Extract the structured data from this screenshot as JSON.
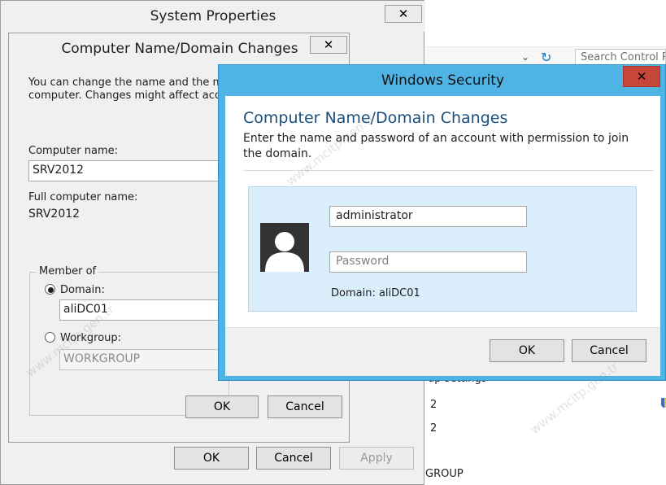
{
  "system_properties": {
    "title": "System Properties",
    "close_glyph": "✕",
    "ok_label": "OK",
    "cancel_label": "Cancel",
    "apply_label": "Apply"
  },
  "computer_name_dialog": {
    "title": "Computer Name/Domain Changes",
    "close_glyph": "✕",
    "intro_line1": "You can change the name and the mem",
    "intro_line2": "computer. Changes might affect access",
    "computer_name_label": "Computer name:",
    "computer_name_value": "SRV2012",
    "full_name_label": "Full computer name:",
    "full_name_value": "SRV2012",
    "member_of_label": "Member of",
    "domain_label": "Domain:",
    "domain_value": "aliDC01",
    "workgroup_label": "Workgroup:",
    "workgroup_value": "WORKGROUP",
    "ok_label": "OK",
    "cancel_label": "Cancel"
  },
  "windows_security": {
    "title": "Windows Security",
    "close_glyph": "✕",
    "heading": "Computer Name/Domain Changes",
    "description": "Enter the name and password of an account with permission to join the domain.",
    "username_value": "administrator",
    "password_placeholder": "Password",
    "domain_text": "Domain: aliDC01",
    "ok_label": "OK",
    "cancel_label": "Cancel",
    "accent_color": "#4fb3e3",
    "close_color": "#c7463a"
  },
  "background_window": {
    "search_placeholder": "Search Control P",
    "fragment_settings": "up settings",
    "fragment_2a": "2",
    "fragment_2b": "2",
    "fragment_group": "GROUP"
  },
  "watermark": "www.mcitp.gen.tr"
}
